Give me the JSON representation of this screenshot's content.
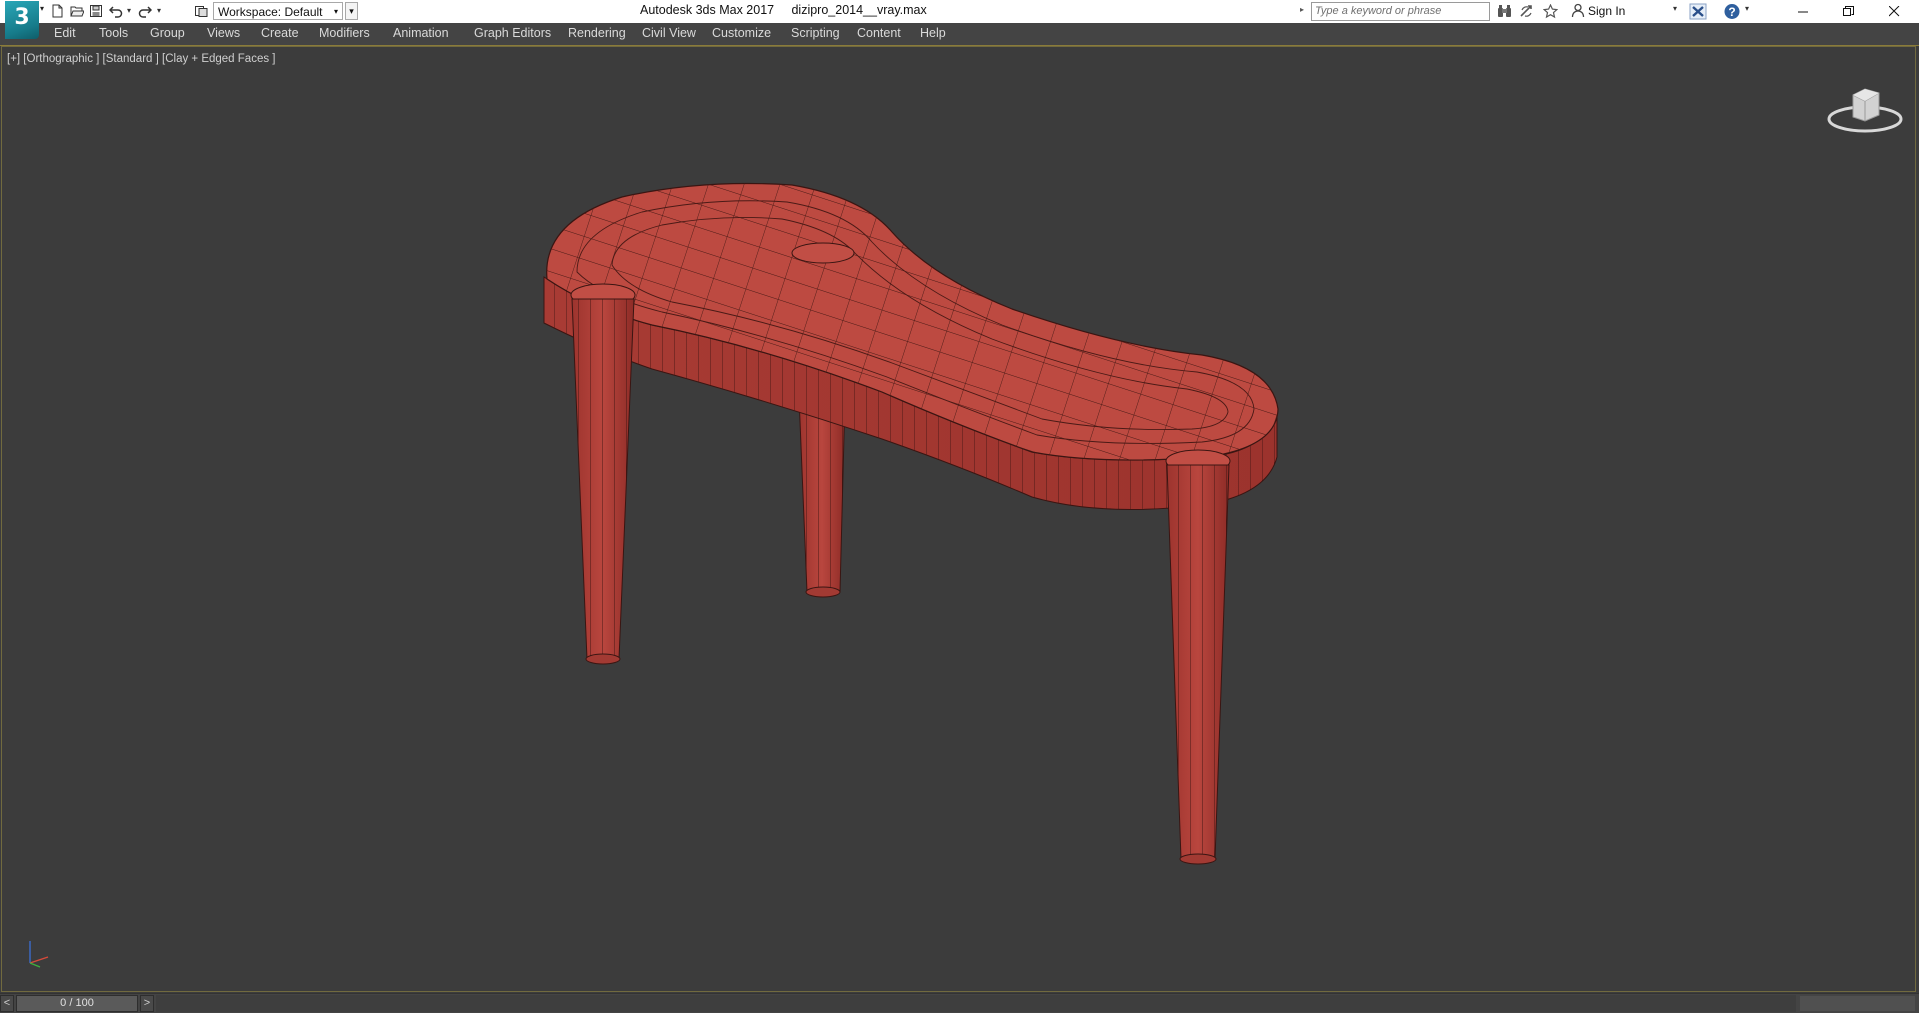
{
  "titlebar": {
    "app_logo_text": "3",
    "workspace": "Workspace: Default",
    "window_title": "Autodesk 3ds Max 2017     dizipro_2014__vray.max",
    "search_placeholder": "Type a keyword or phrase",
    "sign_in": "Sign In"
  },
  "menu": {
    "items": [
      "Edit",
      "Tools",
      "Group",
      "Views",
      "Create",
      "Modifiers",
      "Animation",
      "Graph Editors",
      "Rendering",
      "Civil View",
      "Customize",
      "Scripting",
      "Content",
      "Help"
    ]
  },
  "viewport": {
    "label": "[+] [Orthographic ] [Standard ] [Clay + Edged Faces ]",
    "object_color": "#b8463f",
    "wire_color": "#3a1512",
    "background": "#3c3c3c"
  },
  "timeslider": {
    "frame": "0 / 100",
    "prev": "<",
    "next": ">"
  },
  "icons": {
    "new": "new-file-icon",
    "open": "open-folder-icon",
    "save": "save-icon",
    "undo": "undo-icon",
    "redo": "redo-icon",
    "project": "project-folder-icon",
    "binoculars": "binoculars-icon",
    "exchange": "exchange-icon",
    "favorites": "star-icon",
    "user": "user-icon",
    "x": "autodesk-x-icon",
    "help": "help-icon"
  }
}
